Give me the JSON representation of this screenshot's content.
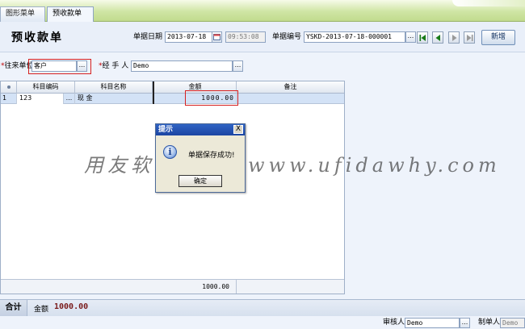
{
  "tabs": [
    {
      "label": "图形菜单"
    },
    {
      "label": "预收款单"
    }
  ],
  "header": {
    "title": "预收款单",
    "date_label": "单据日期",
    "date_value": "2013-07-18",
    "time_value": "09:53:08",
    "number_label": "单据编号",
    "number_value": "YSKD-2013-07-18-000001",
    "new_button": "新增"
  },
  "party": {
    "required_mark": "*",
    "partner_label": "往来单位",
    "partner_value": "客户",
    "handler_label": "经 手 人",
    "handler_value": "Demo"
  },
  "grid": {
    "columns": [
      "科目编码",
      "科目名称",
      "金额",
      "备注"
    ],
    "rows": [
      {
        "index": "1",
        "code": "123",
        "name": "现    金",
        "amount": "1000.00",
        "note": ""
      }
    ],
    "footer_amount": "1000.00"
  },
  "dialog": {
    "title": "提示",
    "close": "X",
    "icon": "i",
    "message": "单据保存成功!",
    "ok": "确定"
  },
  "watermark": "用友软件下载：www.ufidawhy.com",
  "totals": {
    "label": "合计",
    "amount_label": "金额",
    "amount_value": "1000.00"
  },
  "footer": {
    "reviewer_label": "审核人",
    "reviewer_value": "Demo",
    "maker_label": "制单人",
    "maker_value": "Demo"
  },
  "ellipsis": "..."
}
